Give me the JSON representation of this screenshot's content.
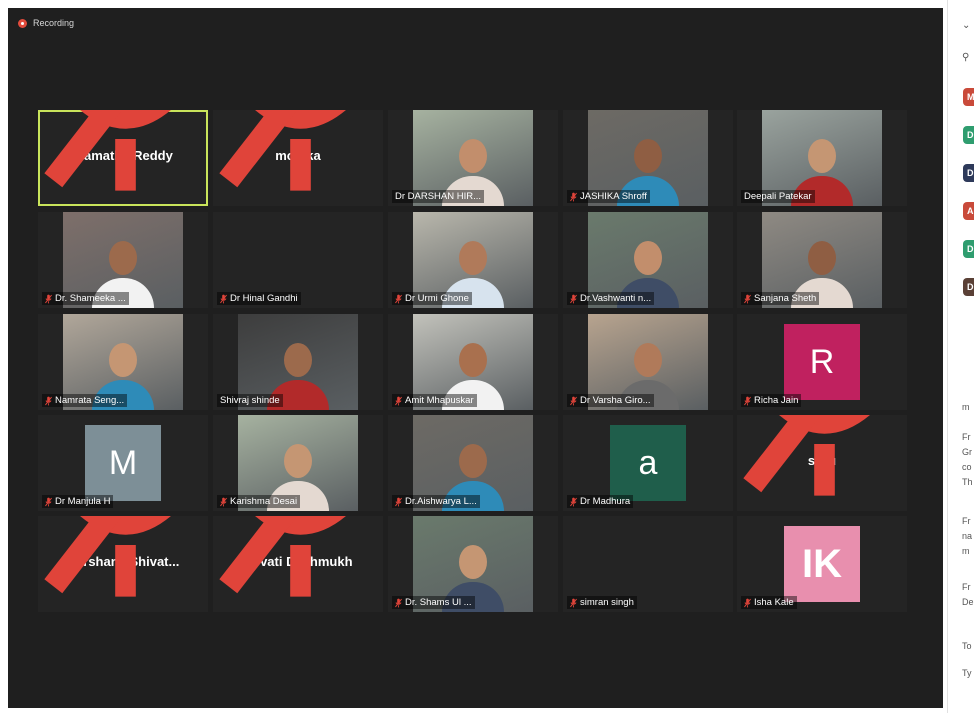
{
  "recording": {
    "label": "Recording",
    "color": "#e24b3c"
  },
  "active_speaker_color": "#c9e45b",
  "participants": [
    {
      "name": "Mamatha Reddy",
      "type": "name",
      "muted": true,
      "active": true
    },
    {
      "name": "monika",
      "type": "name",
      "muted": true
    },
    {
      "name": "Dr DARSHAN HIR...",
      "type": "video",
      "muted": false
    },
    {
      "name": "JASHIKA Shroff",
      "type": "video",
      "muted": true
    },
    {
      "name": "Deepali Patekar",
      "type": "video",
      "muted": false
    },
    {
      "name": "Dr. Shameeka ...",
      "type": "video",
      "muted": true
    },
    {
      "name": "Dr Hinal Gandhi",
      "type": "blank",
      "muted": true
    },
    {
      "name": "Dr Urmi Ghone",
      "type": "video",
      "muted": true
    },
    {
      "name": "Dr.Vashwanti n...",
      "type": "video",
      "muted": true
    },
    {
      "name": "Sanjana Sheth",
      "type": "video",
      "muted": true
    },
    {
      "name": "Namrata Seng...",
      "type": "video",
      "muted": true
    },
    {
      "name": "Shivraj shinde",
      "type": "video",
      "muted": false
    },
    {
      "name": "Amit Mhapuskar",
      "type": "video",
      "muted": true
    },
    {
      "name": "Dr Varsha Giro...",
      "type": "video",
      "muted": true
    },
    {
      "name": "Richa Jain",
      "type": "avatar",
      "letter": "R",
      "color": "#c0215f",
      "muted": true
    },
    {
      "name": "Dr Manjula H",
      "type": "avatar",
      "letter": "M",
      "color": "#7d8f97",
      "muted": true
    },
    {
      "name": "Karishma Desai",
      "type": "video",
      "muted": true
    },
    {
      "name": "Dr.Aishwarya L...",
      "type": "video",
      "muted": true
    },
    {
      "name": "Dr Madhura",
      "type": "avatar",
      "letter": "a",
      "color": "#1f5e4b",
      "muted": true
    },
    {
      "name": "shru",
      "type": "name",
      "muted": true
    },
    {
      "name": "Darshana Shivat...",
      "type": "name",
      "muted": true
    },
    {
      "name": "Revati Deshmukh",
      "type": "name",
      "muted": true
    },
    {
      "name": "Dr. Shams Ul ...",
      "type": "video",
      "muted": true
    },
    {
      "name": "simran singh",
      "type": "blank",
      "muted": true
    },
    {
      "name": "Isha Kale",
      "type": "avatar",
      "letter": "IK",
      "color": "#e88fae",
      "muted": true
    }
  ],
  "side_panel": {
    "chips": [
      {
        "text": "M",
        "color": "#c94a3a"
      },
      {
        "text": "D",
        "color": "#2f9d6f"
      },
      {
        "text": "D",
        "color": "#2e3a5a"
      },
      {
        "text": "AI",
        "color": "#c94a3a"
      },
      {
        "text": "D",
        "color": "#2f9d6f"
      },
      {
        "text": "D",
        "color": "#5a4036"
      }
    ],
    "lines": [
      "m",
      "Fr",
      "Gr",
      "co",
      "Th",
      "Fr",
      "na",
      "m",
      "Fr",
      "De",
      "To",
      "Ty"
    ]
  }
}
